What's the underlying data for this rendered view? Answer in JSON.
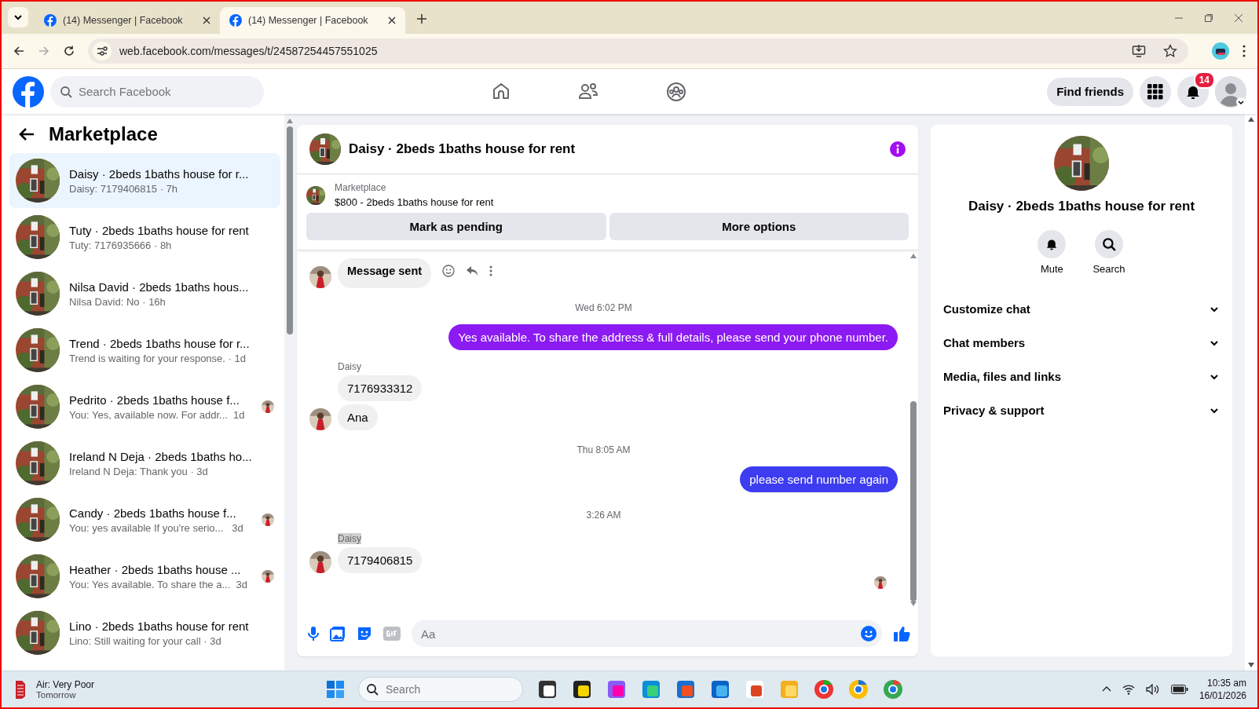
{
  "browser": {
    "tabs": [
      {
        "title": "(14) Messenger | Facebook",
        "selected": false
      },
      {
        "title": "(14) Messenger | Facebook",
        "selected": true
      }
    ],
    "url": "web.facebook.com/messages/t/24587254457551025"
  },
  "header": {
    "search_placeholder": "Search Facebook",
    "find_friends": "Find friends",
    "notification_count": "14"
  },
  "sidebar": {
    "title": "Marketplace",
    "conversations": [
      {
        "name": "Daisy · 2beds 1baths house for r...",
        "preview": "Daisy: 7179406815 · 7h",
        "selected": true,
        "seen_by_avatar": false
      },
      {
        "name": "Tuty · 2beds 1baths house for rent",
        "preview": "Tuty: 7176935666 · 8h",
        "selected": false,
        "seen_by_avatar": false
      },
      {
        "name": "Nilsa David · 2beds 1baths hous...",
        "preview": "Nilsa David: No · 16h",
        "selected": false,
        "seen_by_avatar": false
      },
      {
        "name": "Trend · 2beds 1baths house for r...",
        "preview": "Trend is waiting for your response. · 1d",
        "selected": false,
        "seen_by_avatar": false
      },
      {
        "name": "Pedrito · 2beds 1baths house f...",
        "preview": "You: Yes, available now. For addr...  1d",
        "selected": false,
        "seen_by_avatar": true
      },
      {
        "name": "Ireland N Deja · 2beds 1baths ho...",
        "preview": "Ireland N Deja: Thank you · 3d",
        "selected": false,
        "seen_by_avatar": false
      },
      {
        "name": "Candy · 2beds 1baths house f...",
        "preview": "You: yes available If you're serio...   3d",
        "selected": false,
        "seen_by_avatar": true
      },
      {
        "name": "Heather · 2beds 1baths house ...",
        "preview": "You: Yes available. To share the a...  3d",
        "selected": false,
        "seen_by_avatar": true
      },
      {
        "name": "Lino · 2beds 1baths house for rent",
        "preview": "Lino: Still waiting for your call · 3d",
        "selected": false,
        "seen_by_avatar": false
      }
    ]
  },
  "chat": {
    "title": "Daisy · 2beds 1baths house for rent",
    "listing": {
      "label": "Marketplace",
      "title": "$800 - 2beds 1baths house for rent"
    },
    "actions": [
      "Mark as pending",
      "More options"
    ],
    "messages": [
      {
        "kind": "incoming",
        "text": "Message sent",
        "avatar": true,
        "hovered": true
      },
      {
        "kind": "timestamp",
        "text": "Wed 6:02 PM"
      },
      {
        "kind": "outgoing",
        "text": "Yes available. To share the address & full details, please send your phone number.",
        "color": "#8c1af2"
      },
      {
        "kind": "sender",
        "text": "Daisy",
        "highlighted": false
      },
      {
        "kind": "incoming",
        "text": "7176933312",
        "avatar": false,
        "hovered": false
      },
      {
        "kind": "incoming",
        "text": "Ana",
        "avatar": true,
        "hovered": false
      },
      {
        "kind": "timestamp",
        "text": "Thu 8:05 AM"
      },
      {
        "kind": "outgoing",
        "text": "please send number again",
        "color": "#3d3cf0"
      },
      {
        "kind": "timestamp",
        "text": "3:26 AM"
      },
      {
        "kind": "sender",
        "text": "Daisy",
        "highlighted": true
      },
      {
        "kind": "incoming",
        "text": "7179406815",
        "avatar": true,
        "hovered": false
      }
    ],
    "seen": true,
    "composer_placeholder": "Aa"
  },
  "details": {
    "name": "Daisy · 2beds 1baths house for rent",
    "actions": [
      {
        "label": "Mute",
        "kind": "bell"
      },
      {
        "label": "Search",
        "kind": "search"
      }
    ],
    "sections": [
      "Customize chat",
      "Chat members",
      "Media, files and links",
      "Privacy & support"
    ]
  },
  "taskbar": {
    "weather_title": "Air: Very Poor",
    "weather_subtitle": "Tomorrow",
    "search_placeholder": "Search",
    "time": "10:35 am",
    "date": "16/01/2026"
  }
}
